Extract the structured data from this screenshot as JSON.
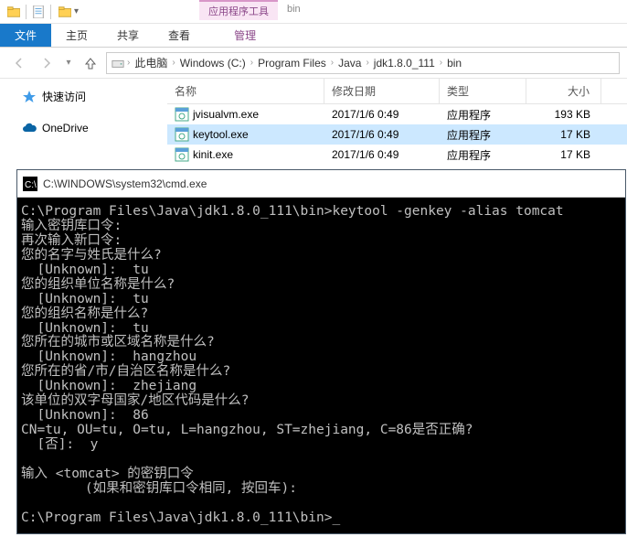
{
  "context_tab": {
    "label": "应用程序工具",
    "subtab": "管理",
    "bin": "bin"
  },
  "ribbon": {
    "tabs": [
      "文件",
      "主页",
      "共享",
      "查看"
    ],
    "active_index": 0
  },
  "breadcrumb": [
    "此电脑",
    "Windows (C:)",
    "Program Files",
    "Java",
    "jdk1.8.0_111",
    "bin"
  ],
  "sidebar": {
    "items": [
      {
        "icon": "star",
        "label": "快速访问"
      },
      {
        "icon": "cloud",
        "label": "OneDrive"
      }
    ]
  },
  "file_list": {
    "headers": {
      "name": "名称",
      "date": "修改日期",
      "type": "类型",
      "size": "大小"
    },
    "rows": [
      {
        "name": "jvisualvm.exe",
        "date": "2017/1/6 0:49",
        "type": "应用程序",
        "size": "193 KB",
        "selected": false
      },
      {
        "name": "keytool.exe",
        "date": "2017/1/6 0:49",
        "type": "应用程序",
        "size": "17 KB",
        "selected": true
      },
      {
        "name": "kinit.exe",
        "date": "2017/1/6 0:49",
        "type": "应用程序",
        "size": "17 KB",
        "selected": false
      }
    ]
  },
  "cmd": {
    "title": "C:\\WINDOWS\\system32\\cmd.exe",
    "lines": "C:\\Program Files\\Java\\jdk1.8.0_111\\bin>keytool -genkey -alias tomcat\n输入密钥库口令:\n再次输入新口令:\n您的名字与姓氏是什么?\n  [Unknown]:  tu\n您的组织单位名称是什么?\n  [Unknown]:  tu\n您的组织名称是什么?\n  [Unknown]:  tu\n您所在的城市或区域名称是什么?\n  [Unknown]:  hangzhou\n您所在的省/市/自治区名称是什么?\n  [Unknown]:  zhejiang\n该单位的双字母国家/地区代码是什么?\n  [Unknown]:  86\nCN=tu, OU=tu, O=tu, L=hangzhou, ST=zhejiang, C=86是否正确?\n  [否]:  y\n\n输入 <tomcat> 的密钥口令\n        (如果和密钥库口令相同, 按回车):\n\nC:\\Program Files\\Java\\jdk1.8.0_111\\bin>_"
  }
}
